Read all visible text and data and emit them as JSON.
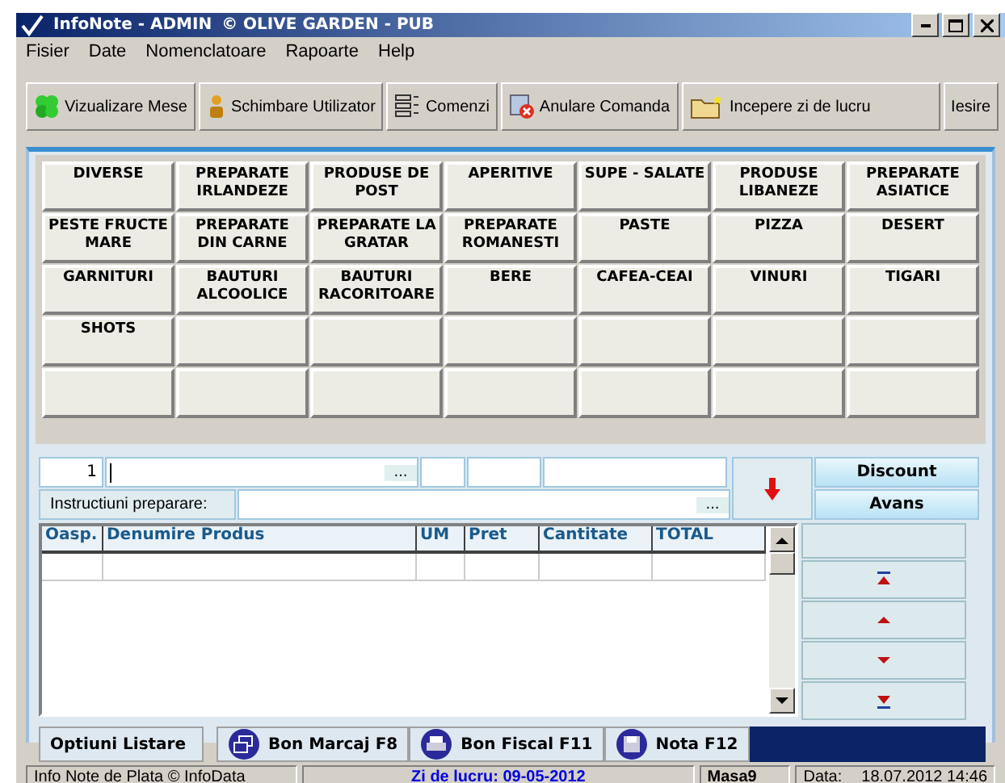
{
  "window": {
    "title": "InfoNote  - ADMIN",
    "subtitle": "© OLIVE GARDEN - PUB"
  },
  "menu": [
    "Fisier",
    "Date",
    "Nomenclatoare",
    "Rapoarte",
    "Help"
  ],
  "toolbar": [
    "Vizualizare Mese",
    "Schimbare Utilizator",
    "Comenzi",
    "Anulare Comanda",
    "Incepere zi de lucru",
    "Iesire"
  ],
  "categories": [
    "DIVERSE",
    "PREPARATE IRLANDEZE",
    "PRODUSE DE POST",
    "APERITIVE",
    "SUPE - SALATE",
    "PRODUSE LIBANEZE",
    "PREPARATE ASIATICE",
    "PESTE FRUCTE MARE",
    "PREPARATE DIN CARNE",
    "PREPARATE LA GRATAR",
    "PREPARATE ROMANESTI",
    "PASTE",
    "PIZZA",
    "DESERT",
    "GARNITURI",
    "BAUTURI ALCOOLICE",
    "BAUTURI RACORITOARE",
    "BERE",
    "CAFEA-CEAI",
    "VINURI",
    "TIGARI",
    "SHOTS"
  ],
  "entry": {
    "quantity": "1",
    "browse": "...",
    "instructions_label": "Instructiuni preparare:",
    "instructions_browse": "..."
  },
  "side_buttons": [
    "Discount",
    "Avans"
  ],
  "table": {
    "columns": [
      "Oasp.",
      "Denumire Produs",
      "UM",
      "Pret",
      "Cantitate",
      "TOTAL"
    ]
  },
  "nav_buttons": [
    {
      "kind": "blank"
    },
    {
      "kind": "first"
    },
    {
      "kind": "up"
    },
    {
      "kind": "down"
    },
    {
      "kind": "last"
    }
  ],
  "print": {
    "label": "Optiuni Listare",
    "buttons": [
      "Bon Marcaj F8",
      "Bon Fiscal F11",
      "Nota F12"
    ]
  },
  "status_bar": {
    "app": "Info Note de Plata © InfoData",
    "workday": "Zi de lucru: 09-05-2012",
    "table": "Masa9",
    "date_label": "Data:",
    "date": "18.07.2012 14:46"
  }
}
